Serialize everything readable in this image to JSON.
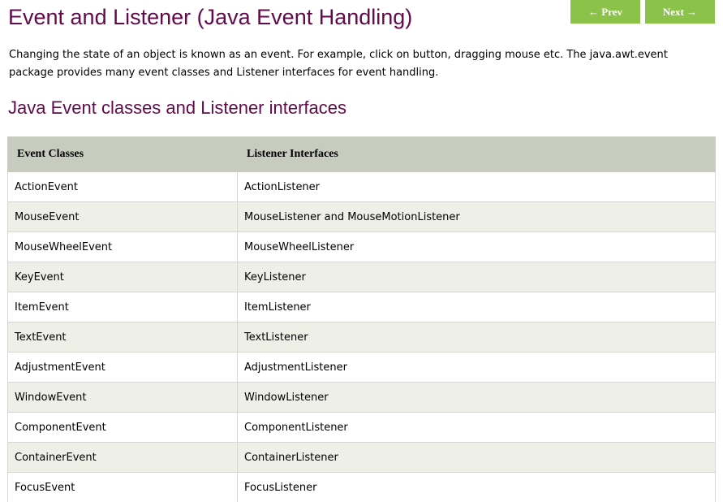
{
  "header": {
    "title": "Event and Listener (Java Event Handling)",
    "prev_label": "← Prev",
    "next_label": "Next →"
  },
  "intro": {
    "text": "Changing the state of an object is known as an event. For example, click on button, dragging mouse etc. The java.awt.event package provides many event classes and Listener interfaces for event handling."
  },
  "section": {
    "heading": "Java Event classes and Listener interfaces"
  },
  "table": {
    "headers": [
      "Event Classes",
      "Listener Interfaces"
    ],
    "rows": [
      [
        "ActionEvent",
        "ActionListener"
      ],
      [
        "MouseEvent",
        "MouseListener and MouseMotionListener"
      ],
      [
        "MouseWheelEvent",
        "MouseWheelListener"
      ],
      [
        "KeyEvent",
        "KeyListener"
      ],
      [
        "ItemEvent",
        "ItemListener"
      ],
      [
        "TextEvent",
        "TextListener"
      ],
      [
        "AdjustmentEvent",
        "AdjustmentListener"
      ],
      [
        "WindowEvent",
        "WindowListener"
      ],
      [
        "ComponentEvent",
        "ComponentListener"
      ],
      [
        "ContainerEvent",
        "ContainerListener"
      ],
      [
        "FocusEvent",
        "FocusListener"
      ]
    ]
  },
  "colors": {
    "heading": "#610b4b",
    "nav_button": "#8bc34a",
    "table_header": "#c7ccbe",
    "row_alt": "#eef0e8"
  }
}
